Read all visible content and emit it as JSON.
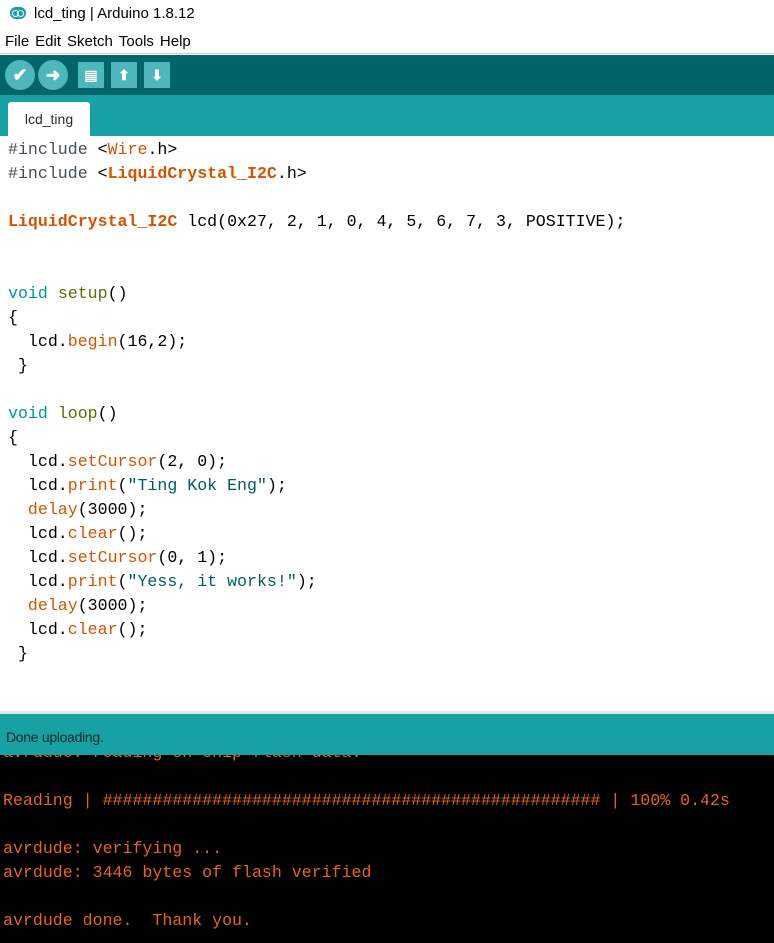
{
  "window": {
    "title": "lcd_ting | Arduino 1.8.12",
    "icon": "arduino-logo-icon"
  },
  "menu": [
    "File",
    "Edit",
    "Sketch",
    "Tools",
    "Help"
  ],
  "toolbar": [
    {
      "name": "verify-button",
      "icon": "check-icon",
      "glyph": "✔"
    },
    {
      "name": "upload-button",
      "icon": "arrow-right-icon",
      "glyph": "➜"
    },
    {
      "name": "new-button",
      "icon": "document-icon",
      "glyph": "▤"
    },
    {
      "name": "open-button",
      "icon": "arrow-up-icon",
      "glyph": "⬆"
    },
    {
      "name": "save-button",
      "icon": "arrow-down-icon",
      "glyph": "⬇"
    }
  ],
  "tab": {
    "label": "lcd_ting"
  },
  "colors": {
    "keyword": "#00979C",
    "function": "#D35400",
    "setupfn": "#5E6D03",
    "string": "#005C5F",
    "preproc": "#434F54",
    "toolbar": "#006468",
    "accent": "#17A1A5",
    "console_text": "#E8631A"
  },
  "code": [
    [
      [
        "#include ",
        "preproc"
      ],
      [
        "<",
        ""
      ],
      [
        "Wire",
        "function"
      ],
      [
        ".h>",
        ""
      ]
    ],
    [
      [
        "#include ",
        "preproc"
      ],
      [
        "<",
        ""
      ],
      [
        "LiquidCrystal_I2C",
        "bold"
      ],
      [
        ".h>",
        ""
      ]
    ],
    [],
    [
      [
        "LiquidCrystal_I2C",
        "bold"
      ],
      [
        " lcd(0x27, 2, 1, 0, 4, 5, 6, 7, 3, POSITIVE);",
        ""
      ]
    ],
    [],
    [],
    [
      [
        "void",
        "keyword"
      ],
      [
        " ",
        ""
      ],
      [
        "setup",
        "setupfn"
      ],
      [
        "()",
        ""
      ]
    ],
    [
      [
        "{",
        ""
      ]
    ],
    [
      [
        "  lcd.",
        ""
      ],
      [
        "begin",
        "function"
      ],
      [
        "(16,2);",
        ""
      ]
    ],
    [
      [
        " }",
        ""
      ]
    ],
    [],
    [
      [
        "void",
        "keyword"
      ],
      [
        " ",
        ""
      ],
      [
        "loop",
        "setupfn"
      ],
      [
        "()",
        ""
      ]
    ],
    [
      [
        "{",
        ""
      ]
    ],
    [
      [
        "  lcd.",
        ""
      ],
      [
        "setCursor",
        "function"
      ],
      [
        "(2, 0);",
        ""
      ]
    ],
    [
      [
        "  lcd.",
        ""
      ],
      [
        "print",
        "function"
      ],
      [
        "(",
        ""
      ],
      [
        "\"Ting Kok Eng\"",
        "string"
      ],
      [
        ");",
        ""
      ]
    ],
    [
      [
        "  ",
        ""
      ],
      [
        "delay",
        "function"
      ],
      [
        "(3000);",
        ""
      ]
    ],
    [
      [
        "  lcd.",
        ""
      ],
      [
        "clear",
        "function"
      ],
      [
        "();",
        ""
      ]
    ],
    [
      [
        "  lcd.",
        ""
      ],
      [
        "setCursor",
        "function"
      ],
      [
        "(0, 1);",
        ""
      ]
    ],
    [
      [
        "  lcd.",
        ""
      ],
      [
        "print",
        "function"
      ],
      [
        "(",
        ""
      ],
      [
        "\"Yess, it works!\"",
        "string"
      ],
      [
        ");",
        ""
      ]
    ],
    [
      [
        "  ",
        ""
      ],
      [
        "delay",
        "function"
      ],
      [
        "(3000);",
        ""
      ]
    ],
    [
      [
        "  lcd.",
        ""
      ],
      [
        "clear",
        "function"
      ],
      [
        "();",
        ""
      ]
    ],
    [
      [
        " }",
        ""
      ]
    ]
  ],
  "status": {
    "message": "Done uploading."
  },
  "console": [
    "avrdude: reading on-chip flash data:",
    "",
    "Reading | ################################################## | 100% 0.42s",
    "",
    "avrdude: verifying ...",
    "avrdude: 3446 bytes of flash verified",
    "",
    "avrdude done.  Thank you."
  ]
}
